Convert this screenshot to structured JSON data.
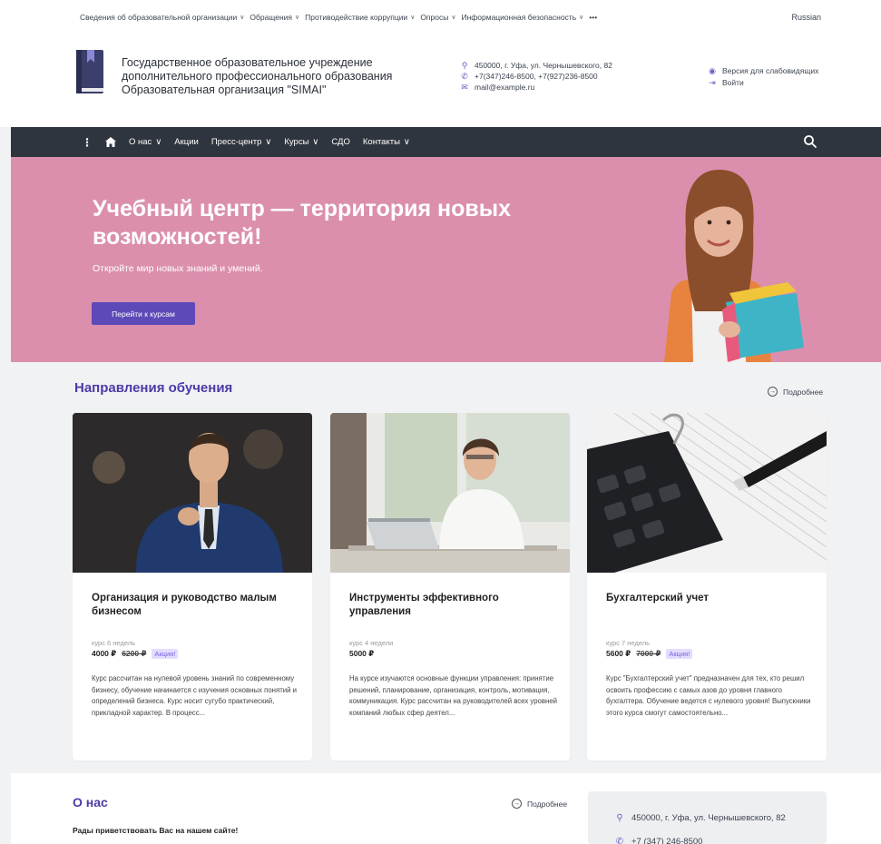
{
  "topbar": {
    "items": [
      "Сведения об образовательной организации",
      "Обращения",
      "Противодействие коррупции",
      "Опросы",
      "Информационная безопасность"
    ],
    "more": "•••",
    "language": "Russian"
  },
  "header": {
    "org_line1": "Государственное образовательное учреждение",
    "org_line2": "дополнительного профессионального образования",
    "org_line3": "Образовательная организация \"SIMAI\"",
    "address": "450000, г. Уфа, ул. Чернышевского, 82",
    "phones": "+7(347)246-8500, +7(927)236-8500",
    "email": "mail@example.ru",
    "accessibility": "Версия для слабовидящих",
    "login": "Войти"
  },
  "nav": {
    "items": [
      {
        "label": "О нас",
        "dropdown": true
      },
      {
        "label": "Акции",
        "dropdown": false
      },
      {
        "label": "Пресс-центр",
        "dropdown": true
      },
      {
        "label": "Курсы",
        "dropdown": true
      },
      {
        "label": "СДО",
        "dropdown": false
      },
      {
        "label": "Контакты",
        "dropdown": true
      }
    ]
  },
  "hero": {
    "title": "Учебный центр — территория новых возможностей!",
    "subtitle": "Откройте мир новых знаний и умений.",
    "button": "Перейти к курсам",
    "bg_color": "#db8fad"
  },
  "directions": {
    "title": "Направления обучения",
    "more": "Подробнее",
    "cards": [
      {
        "title": "Организация и руководство малым бизнесом",
        "duration": "курс 6 недель",
        "price": "4000 ₽",
        "old_price": "6200 ₽",
        "promo": "Акция!",
        "description": "Курс рассчитан на нулевой уровень знаний по современному бизнесу, обучение начинается с изучения основных понятий и определений бизнеса. Курс носит сугубо практический, прикладной характер. В процесс..."
      },
      {
        "title": "Инструменты эффективного управления",
        "duration": "курс 4 недели",
        "price": "5000 ₽",
        "old_price": "",
        "promo": "",
        "description": "На курсе изучаются основные функции управления: принятие решений, планирование, организация, контроль, мотивация, коммуникация. Курс рассчитан на  руководителей всех уровней компаний любых сфер деятел..."
      },
      {
        "title": "Бухгалтерский учет",
        "duration": "курс 7 недель",
        "price": "5600 ₽",
        "old_price": "7000 ₽",
        "promo": "Акция!",
        "description": "Курс \"Бухгалтерский учет\" предназначен для тех, кто решил освоить профессию с самых азов до уровня главного бухгалтера. Обучение ведется с нулевого уровня! Выпускники этого курса смогут самостоятельно..."
      }
    ]
  },
  "about": {
    "title": "О нас",
    "more": "Подробнее",
    "lead": "Рады приветствовать Вас на нашем сайте!",
    "address": "450000, г. Уфа, ул. Чернышевского, 82",
    "phone": "+7 (347) 246-8500"
  },
  "colors": {
    "accent": "#5d49b7",
    "heading": "#4b3aa8",
    "nav_bg": "#2f353e"
  }
}
